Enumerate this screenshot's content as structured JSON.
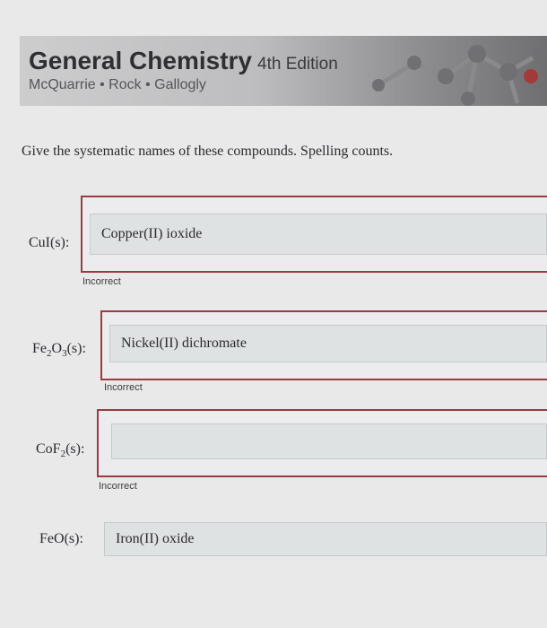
{
  "header": {
    "title": "General Chemistry",
    "edition": "4th Edition",
    "authors": "McQuarrie • Rock • Gallogly"
  },
  "instructions": "Give the systematic names of these compounds. Spelling counts.",
  "questions": [
    {
      "formula_main": "CuI",
      "formula_tail": "(s):",
      "answer": "Copper(II) ioxide",
      "feedback": "Incorrect"
    },
    {
      "formula_parts": [
        "Fe",
        "2",
        "O",
        "3",
        "(s):"
      ],
      "answer": "Nickel(II) dichromate",
      "feedback": "Incorrect"
    },
    {
      "formula_parts": [
        "CoF",
        "2",
        "(s):"
      ],
      "answer": "",
      "feedback": "Incorrect"
    },
    {
      "formula_main": "FeO",
      "formula_tail": "(s):",
      "answer": "Iron(II) oxide"
    }
  ],
  "colors": {
    "incorrect_border": "#9a3b40",
    "field_bg": "#dfe2e2"
  }
}
